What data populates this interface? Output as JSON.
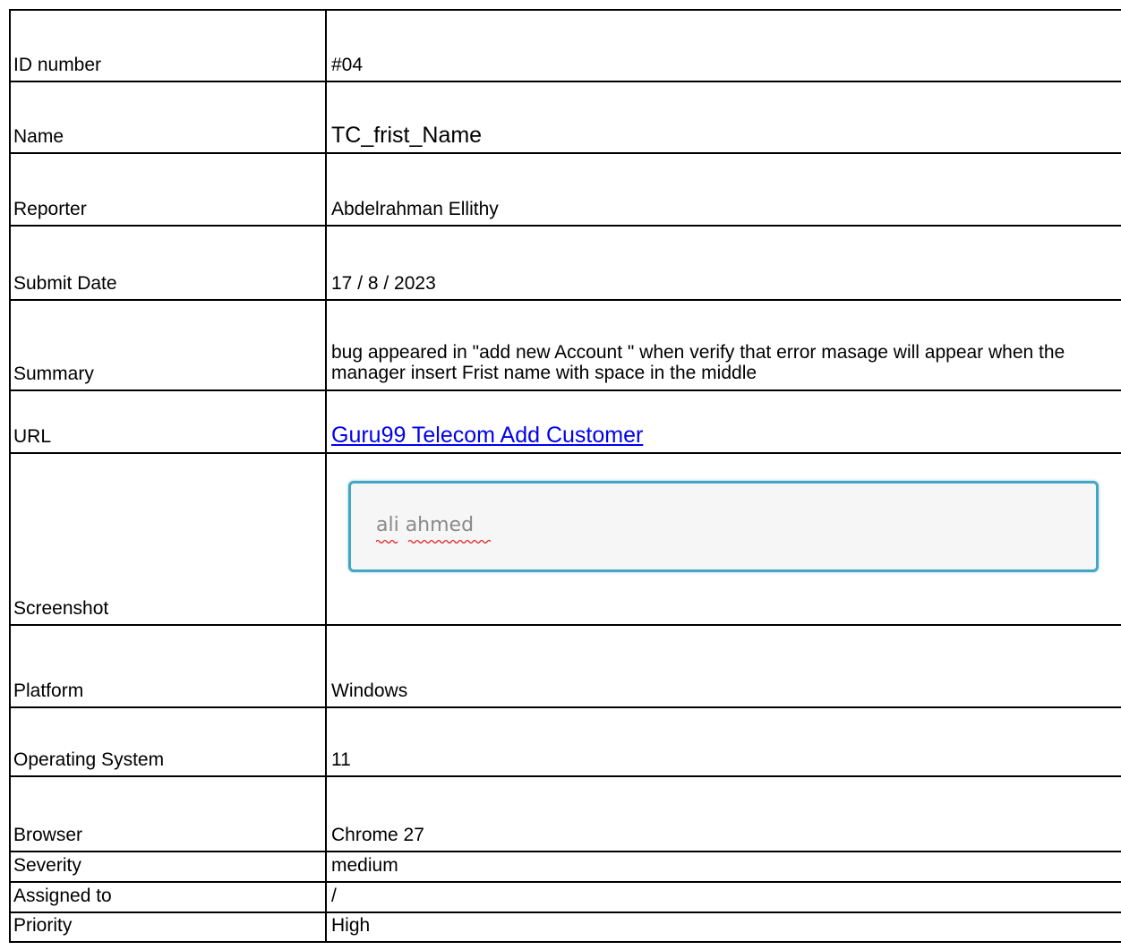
{
  "report": {
    "rows": [
      {
        "label": "ID number",
        "value": "#04"
      },
      {
        "label": "Name",
        "value": "TC_frist_Name"
      },
      {
        "label": "Reporter",
        "value": "Abdelrahman Ellithy"
      },
      {
        "label": "Submit Date",
        "value": "17 / 8 / 2023"
      },
      {
        "label": "Summary",
        "value": "bug appeared in \"add new Account \" when verify that error masage will appear when the manager insert Frist name with space in the middle"
      },
      {
        "label": "URL",
        "value": "Guru99 Telecom Add Customer"
      },
      {
        "label": "Screenshot",
        "value": "ali ahmed"
      },
      {
        "label": "Platform",
        "value": "Windows"
      },
      {
        "label": "Operating System",
        "value": "11"
      },
      {
        "label": "Browser",
        "value": "Chrome 27"
      },
      {
        "label": "Severity",
        "value": "medium"
      },
      {
        "label": "Assigned to",
        "value": "/"
      },
      {
        "label": "Priority",
        "value": "High"
      }
    ]
  },
  "colors": {
    "link": "#0000ee",
    "screenshot_border": "#45a6c4",
    "screenshot_bg": "#f6f6f6",
    "spellcheck_underline": "#e02020"
  }
}
